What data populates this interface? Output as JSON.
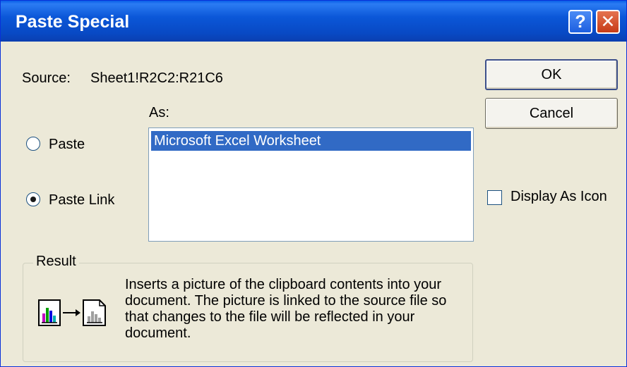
{
  "window": {
    "title": "Paste Special"
  },
  "titlebar": {
    "help_glyph": "?",
    "close_glyph": "✕"
  },
  "source": {
    "label": "Source:",
    "value": "Sheet1!R2C2:R21C6"
  },
  "as": {
    "label": "As:",
    "items": [
      "Microsoft Excel Worksheet"
    ],
    "selected_index": 0
  },
  "options": {
    "paste_label": "Paste",
    "paste_link_label": "Paste Link",
    "selected": "Paste Link"
  },
  "buttons": {
    "ok": "OK",
    "cancel": "Cancel"
  },
  "display_as_icon": {
    "label": "Display As Icon",
    "checked": false
  },
  "result": {
    "title": "Result",
    "text": "Inserts a picture of the clipboard contents into your document.  The picture is linked to the source file so that changes to the file will be reflected in your document."
  },
  "icons": [
    "help-icon",
    "close-icon",
    "paste-link-result-icon"
  ],
  "colors": {
    "titlebar": "#0b57d8",
    "selection": "#316ac5",
    "dialog_bg": "#ece9d8"
  }
}
